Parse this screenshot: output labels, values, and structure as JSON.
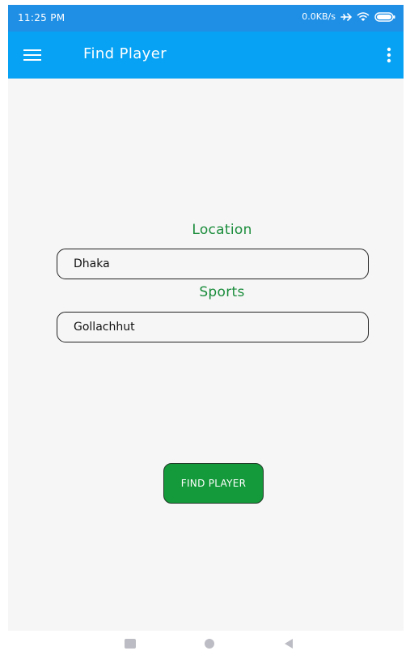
{
  "status_bar": {
    "time": "11:25 PM",
    "network_speed": "0.0KB/s",
    "icons": [
      "airplane-mode-icon",
      "wifi-icon",
      "battery-icon"
    ]
  },
  "app_bar": {
    "title": "Find Player",
    "menu_icon": "hamburger-menu-icon",
    "overflow_icon": "more-vert-icon"
  },
  "form": {
    "location_label": "Location",
    "location_value": "Dhaka",
    "sports_label": "Sports",
    "sports_value": "Gollachhut",
    "submit_label": "FIND PLAYER"
  },
  "nav_bar": {
    "icons": [
      "recent-apps-icon",
      "home-icon",
      "back-icon"
    ]
  },
  "colors": {
    "status_bar": "#1f8fe6",
    "app_bar": "#07a2f3",
    "label_green": "#1b8d3c",
    "button_green": "#159a3b",
    "background": "#f6f6f6"
  }
}
